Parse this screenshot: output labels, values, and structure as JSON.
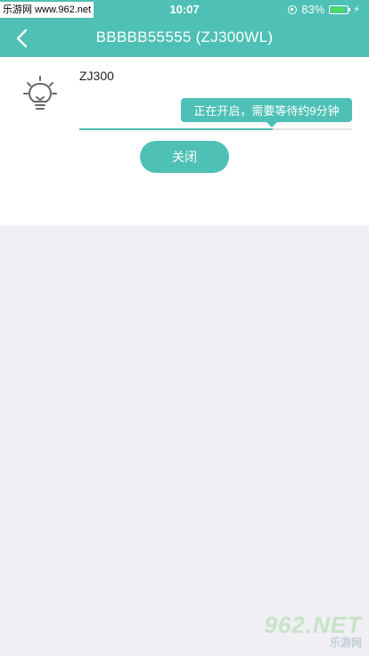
{
  "status_bar": {
    "watermark": "乐游网 www.962.net",
    "time": "10:07",
    "battery_percent_text": "83%",
    "battery_level": 0.83,
    "charging_glyph": "⚡",
    "icons": [
      "rotation-lock-icon",
      "battery-icon",
      "charging-icon"
    ]
  },
  "header": {
    "back_icon": "chevron-left-icon",
    "title": "BBBBB55555 (ZJ300WL)"
  },
  "device": {
    "icon": "light-bulb-icon",
    "name": "ZJ300",
    "status_tooltip": "正在开启，需要等待约9分钟",
    "progress": 0.71,
    "close_label": "关闭"
  },
  "watermark_bottom": {
    "brand": "962.NET",
    "sub": "乐游网"
  },
  "colors": {
    "accent": "#4ec0b5",
    "background": "#efeff4",
    "battery_green": "#4cd964"
  }
}
